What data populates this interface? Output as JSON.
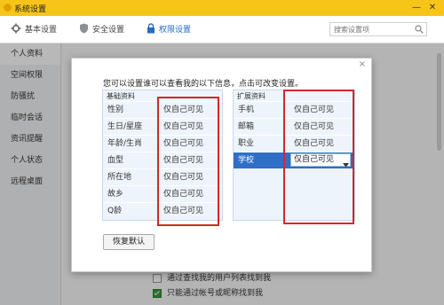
{
  "window": {
    "title": "系统设置",
    "minimize_glyph": "—",
    "close_glyph": "✕"
  },
  "toolbar": {
    "tabs": [
      {
        "label": "基本设置",
        "icon": "gear-icon"
      },
      {
        "label": "安全设置",
        "icon": "shield-icon"
      },
      {
        "label": "权限设置",
        "icon": "lock-icon",
        "active": true
      }
    ],
    "search": {
      "placeholder": "搜索设置项",
      "icon": "search-icon"
    }
  },
  "sidebar": {
    "items": [
      {
        "label": "个人资料",
        "active": true
      },
      {
        "label": "空间权限"
      },
      {
        "label": "防骚扰"
      },
      {
        "label": "临时会话"
      },
      {
        "label": "资讯提醒"
      },
      {
        "label": "个人状态"
      },
      {
        "label": "远程桌面"
      }
    ]
  },
  "main": {
    "options": [
      {
        "label": "通过查找我的用户列表找到我",
        "checked": false
      },
      {
        "label": "只能通过帐号或昵称找到我",
        "checked": true
      }
    ]
  },
  "dialog": {
    "close_glyph": "×",
    "instruction": "您可以设置谁可以查看我的以下信息，点击可改变设置。",
    "basic": {
      "header": "基础资料",
      "rows": [
        {
          "field": "性别",
          "value": "仅自己可见"
        },
        {
          "field": "生日/星座",
          "value": "仅自己可见"
        },
        {
          "field": "年龄/生肖",
          "value": "仅自己可见"
        },
        {
          "field": "血型",
          "value": "仅自己可见"
        },
        {
          "field": "所在地",
          "value": "仅自己可见"
        },
        {
          "field": "故乡",
          "value": "仅自己可见"
        },
        {
          "field": "Q龄",
          "value": "仅自己可见"
        }
      ]
    },
    "extended": {
      "header": "扩展资料",
      "rows": [
        {
          "field": "手机",
          "value": "仅自己可见"
        },
        {
          "field": "邮箱",
          "value": "仅自己可见"
        },
        {
          "field": "职业",
          "value": "仅自己可见"
        },
        {
          "field": "学校",
          "value": "仅自己可见",
          "selected": true,
          "dropdown": true
        }
      ]
    },
    "restore_label": "恢复默认",
    "highlight_color": "#d6262b",
    "selection_color": "#2f6fc6"
  },
  "colors": {
    "titlebar": "#f7c518",
    "accent": "#2a6bc4"
  }
}
